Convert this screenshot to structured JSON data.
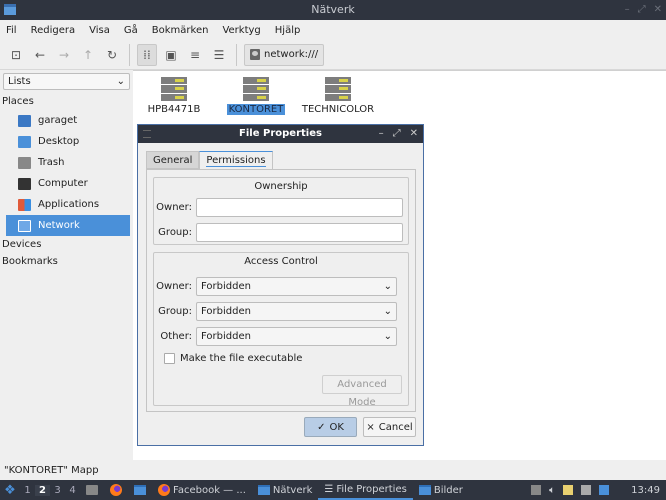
{
  "window": {
    "title": "Nätverk"
  },
  "menu": [
    "Fil",
    "Redigera",
    "Visa",
    "Gå",
    "Bokmärken",
    "Verktyg",
    "Hjälp"
  ],
  "toolbar": {
    "path": "network:///"
  },
  "sidebar": {
    "selector": "Lists",
    "places_label": "Places",
    "items": [
      {
        "label": "garaget",
        "color": "#3b78c4"
      },
      {
        "label": "Desktop",
        "color": "#4a90d9"
      },
      {
        "label": "Trash",
        "color": "#888888"
      },
      {
        "label": "Computer",
        "color": "#333333"
      },
      {
        "label": "Applications",
        "color": "#e07a3a"
      },
      {
        "label": "Network",
        "color": "#ffffff"
      }
    ],
    "devices_label": "Devices",
    "bookmarks_label": "Bookmarks"
  },
  "hosts": [
    {
      "label": "HPB4471B"
    },
    {
      "label": "KONTORET",
      "selected": true
    },
    {
      "label": "TECHNICOLOR"
    }
  ],
  "status": "\"KONTORET\" Mapp",
  "dialog": {
    "title": "File Properties",
    "tabs": [
      "General",
      "Permissions"
    ],
    "ownership": {
      "title": "Ownership",
      "owner_label": "Owner:",
      "owner_value": "",
      "group_label": "Group:",
      "group_value": ""
    },
    "access": {
      "title": "Access Control",
      "owner_label": "Owner:",
      "owner": "Forbidden",
      "group_label": "Group:",
      "group": "Forbidden",
      "other_label": "Other:",
      "other": "Forbidden",
      "exec_label": "Make the file executable",
      "advanced": "Advanced Mode"
    },
    "ok": "OK",
    "cancel": "Cancel"
  },
  "taskbar": {
    "workspaces": [
      "1",
      "2",
      "3",
      "4"
    ],
    "tasks": [
      "Facebook — ...",
      "Nätverk",
      "File Properties",
      "Bilder"
    ],
    "clock": "13:49"
  }
}
